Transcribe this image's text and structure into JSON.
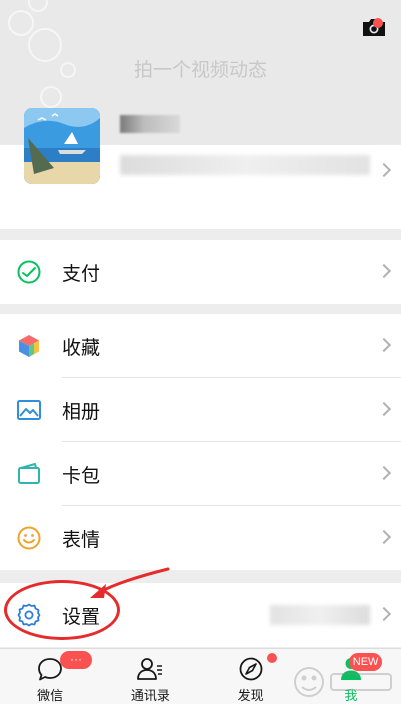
{
  "header": {
    "video_moment_text": "拍一个视频动态"
  },
  "menu": {
    "pay_label": "支付",
    "favorites_label": "收藏",
    "album_label": "相册",
    "cards_label": "卡包",
    "stickers_label": "表情",
    "settings_label": "设置"
  },
  "tabbar": {
    "chats_label": "微信",
    "chats_badge": "···",
    "contacts_label": "通讯录",
    "discover_label": "发现",
    "me_label": "我",
    "me_badge": "NEW"
  },
  "colors": {
    "accent_green": "#07c160",
    "badge_red": "#fa5151",
    "annotation_red": "#e52b2b"
  }
}
